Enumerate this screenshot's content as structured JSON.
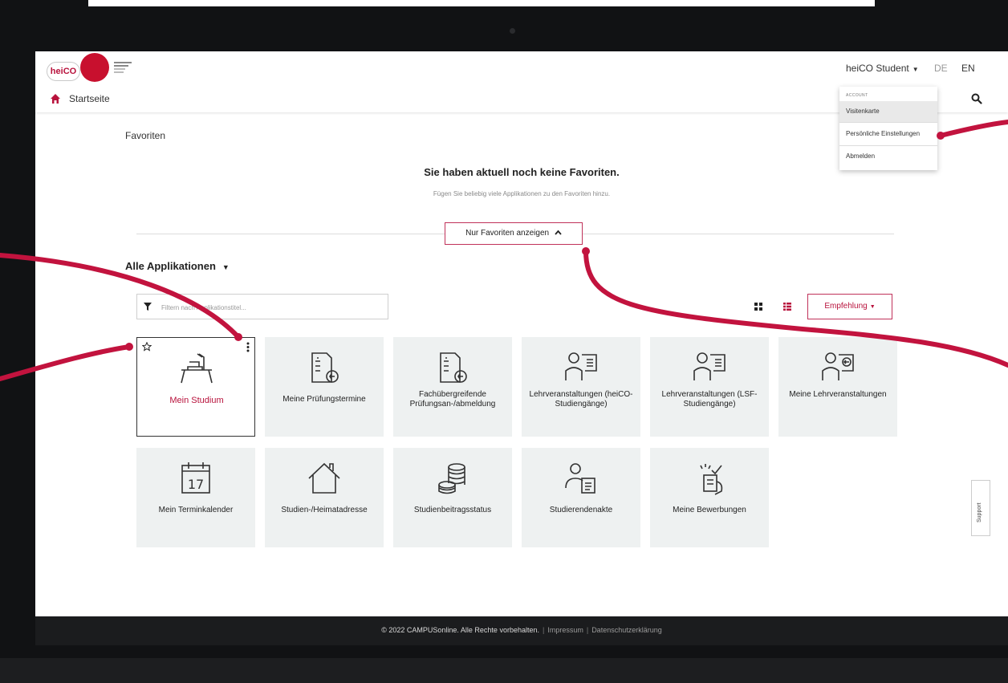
{
  "header": {
    "logo_text": "heiCO",
    "user_menu_label": "heiCO Student",
    "lang_de": "DE",
    "lang_en": "EN",
    "nav_home_label": "Startseite"
  },
  "account_menu": {
    "header": "ACCOUNT",
    "items": [
      {
        "label": "Visitenkarte"
      },
      {
        "label": "Persönliche Einstellungen"
      },
      {
        "label": "Abmelden"
      }
    ]
  },
  "favorites": {
    "title": "Favoriten",
    "empty_message": "Sie haben aktuell noch keine Favoriten.",
    "hint": "Fügen Sie beliebig viele Applikationen zu den Favoriten hinzu.",
    "toggle_label": "Nur Favoriten anzeigen"
  },
  "applications": {
    "heading": "Alle Applikationen",
    "filter_placeholder": "Filtern nach Applikationstitel...",
    "sort_label": "Empfehlung",
    "tiles": [
      {
        "label": "Mein Studium",
        "icon": "desk-icon"
      },
      {
        "label": "Meine Prüfungstermine",
        "icon": "exam-icon"
      },
      {
        "label": "Fachübergreifende Prüfungsan-/abmeldung",
        "icon": "exam-register-icon"
      },
      {
        "label": "Lehrveranstaltungen (heiCO-Studiengänge)",
        "icon": "person-list-icon"
      },
      {
        "label": "Lehrveranstaltungen (LSF-Studiengänge)",
        "icon": "person-list-icon"
      },
      {
        "label": "Meine Lehrveranstaltungen",
        "icon": "person-course-icon"
      },
      {
        "label": "Mein Terminkalender",
        "icon": "calendar-icon",
        "day": "17"
      },
      {
        "label": "Studien-/Heimatadresse",
        "icon": "house-icon"
      },
      {
        "label": "Studienbeitragsstatus",
        "icon": "coins-icon"
      },
      {
        "label": "Studierendenakte",
        "icon": "student-file-icon"
      },
      {
        "label": "Meine Bewerbungen",
        "icon": "application-hand-icon"
      }
    ]
  },
  "support_label": "Support",
  "footer": {
    "copyright": "© 2022 CAMPUSonline. Alle Rechte vorbehalten.",
    "impressum": "Impressum",
    "privacy": "Datenschutzerklärung"
  },
  "colors": {
    "accent": "#b8123c",
    "annotation": "#c2133e",
    "tile_bg": "#eef1f1",
    "bezel": "#111214"
  }
}
